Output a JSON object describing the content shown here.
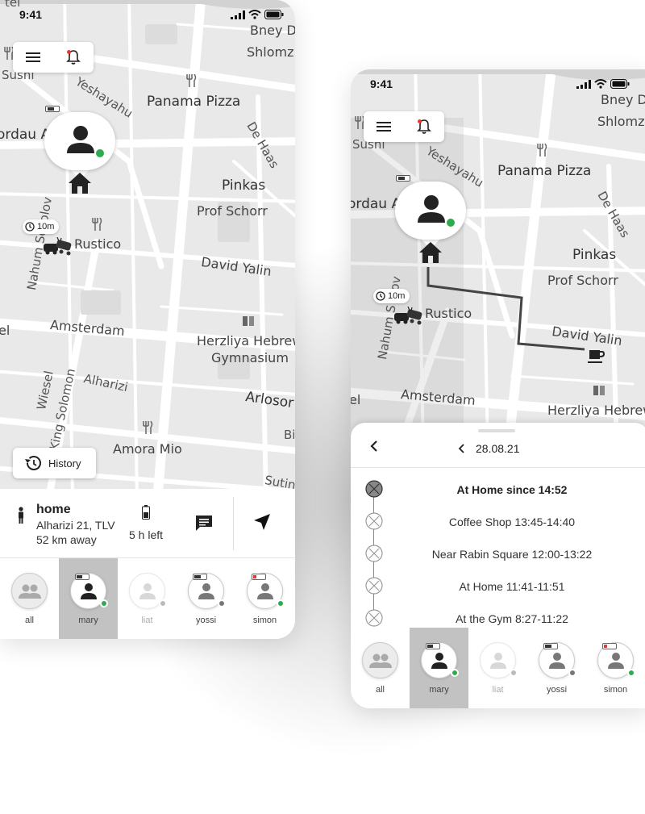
{
  "status_bar": {
    "time": "9:41"
  },
  "map_labels": {
    "tel": "tel",
    "bney": "Bney D",
    "shlomz": "Shlomz",
    "sushi": "Sushi",
    "yeshayahu": "Yeshayahu",
    "panama_pizza": "Panama Pizza",
    "dizengoff": "ordau A",
    "de_haas": "De Haas",
    "pinkas": "Pinkas",
    "prof_schorr": "Prof Schorr",
    "rustico": "Rustico",
    "nahum": "Nahum Sokolov",
    "david_yalin": "David Yalin",
    "amsterdam": "Amsterdam",
    "herzliya": "Herzliya Hebrew",
    "gymnasium": "Gymnasium",
    "el": "el",
    "wiesel": "Wiesel",
    "alharizi": "Alharizi",
    "king_solomon": "King Solomon",
    "arlosor": "Arlosor",
    "bi": "Bi",
    "amora_mio": "Amora Mio",
    "sutin": "Sutin",
    "sokolov_short": "Nahum S olov"
  },
  "time_chip": "10m",
  "history_button": "History",
  "info_panel": {
    "place": "home",
    "address": "Alharizi 21, TLV",
    "distance": "52 km away",
    "battery_left": "5 h left"
  },
  "members": [
    {
      "name": "all",
      "active": false,
      "faded": false,
      "status_color": ""
    },
    {
      "name": "mary",
      "active": true,
      "faded": false,
      "status_color": "#2eaa4f",
      "battery": 0.5,
      "battery_color": "#333"
    },
    {
      "name": "liat",
      "active": false,
      "faded": true,
      "status_color": "#bbbbbb"
    },
    {
      "name": "yossi",
      "active": false,
      "faded": false,
      "status_color": "#777777",
      "battery": 0.6,
      "battery_color": "#333"
    },
    {
      "name": "simon",
      "active": false,
      "faded": false,
      "status_color": "#2eaa4f",
      "battery": 0.3,
      "battery_color": "#e53935"
    }
  ],
  "history_sheet": {
    "date": "28.08.21",
    "items": [
      {
        "label": "At Home since 14:52",
        "current": true
      },
      {
        "label": "Coffee Shop 13:45-14:40",
        "current": false
      },
      {
        "label": "Near Rabin Square 12:00-13:22",
        "current": false
      },
      {
        "label": "At Home 11:41-11:51",
        "current": false
      },
      {
        "label": "At the Gym 8:27-11:22",
        "current": false
      }
    ]
  },
  "colors": {
    "online": "#2eaa4f",
    "alert": "#e53935",
    "active_tab": "#c2c2c2",
    "map_bg": "#e9e9e9",
    "route": "#444444"
  }
}
